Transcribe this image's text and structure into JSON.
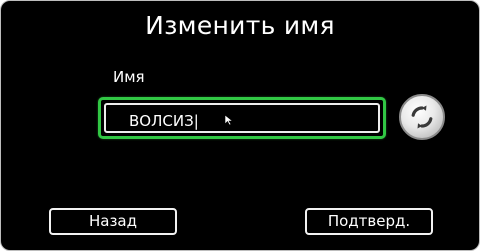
{
  "dialog": {
    "title": "Изменить имя",
    "name_label": "Имя",
    "name_value": "ВОЛСИЗ|",
    "refresh_icon": "refresh-icon",
    "back_label": "Назад",
    "confirm_label": "Подтверд.",
    "colors": {
      "background": "#000000",
      "focus_border": "#31c744",
      "text": "#ffffff"
    }
  }
}
